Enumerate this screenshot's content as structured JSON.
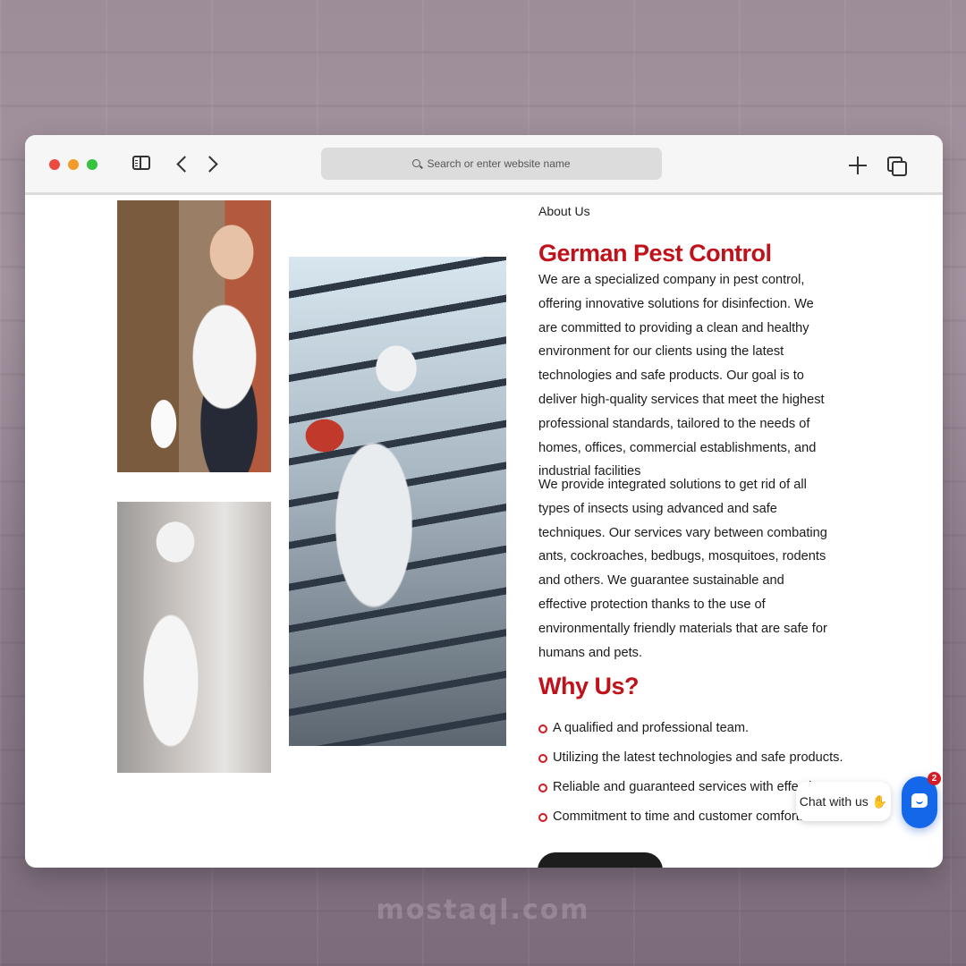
{
  "browser": {
    "search_placeholder": "Search or enter website name"
  },
  "about": {
    "label": "About Us",
    "title": "German Pest Control",
    "paragraph_1": "We are a specialized company in pest control, offering innovative solutions for disinfection. We are committed to providing a clean and healthy environment for our clients using the latest technologies and safe products. Our goal is to deliver high-quality services that meet the highest professional standards, tailored to the needs of homes, offices, commercial establishments, and industrial facilities",
    "paragraph_2": "We provide integrated solutions to get rid of all types of insects using advanced and safe techniques. Our services vary between combating ants, cockroaches, bedbugs, mosquitoes, rodents and others. We guarantee sustainable and effective protection thanks to the use of environmentally friendly materials that are safe for humans and pets."
  },
  "why_us": {
    "title": "Why Us?",
    "items": [
      "A qualified and professional team.",
      "Utilizing the latest technologies and safe products.",
      "Reliable and guaranteed services with effective",
      "Commitment to time and customer comfort."
    ]
  },
  "chat": {
    "label": "Chat with us",
    "badge_count": "2"
  },
  "watermark": "mostaql.com",
  "colors": {
    "accent_red": "#c0121a",
    "chat_blue": "#1467e8"
  },
  "icons": [
    "sidebar-icon",
    "back-icon",
    "forward-icon",
    "search-icon",
    "plus-icon",
    "tabs-icon",
    "bullet-icon",
    "wave-icon",
    "chat-icon"
  ]
}
